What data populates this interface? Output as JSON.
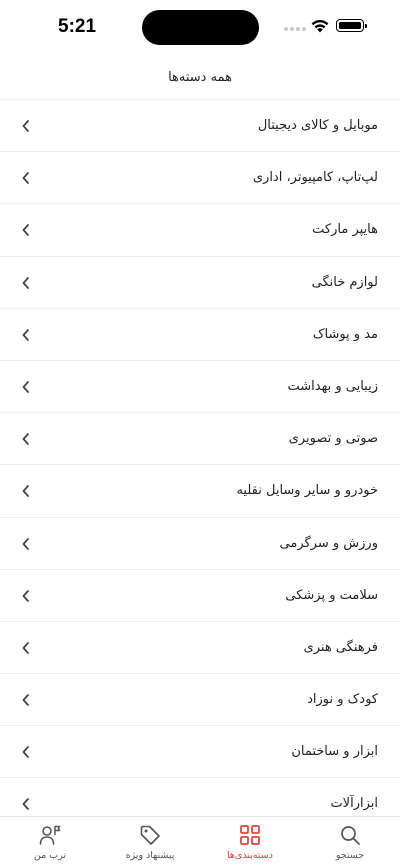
{
  "status_bar": {
    "time": "5:21"
  },
  "header": {
    "title": "همه دسته‌ها"
  },
  "categories": [
    {
      "label": "موبایل و کالای دیجیتال"
    },
    {
      "label": "لپ‌تاپ، کامپیوتر، اداری"
    },
    {
      "label": "هایپر مارکت"
    },
    {
      "label": "لوازم خانگی"
    },
    {
      "label": "مد و پوشاک"
    },
    {
      "label": "زیبایی و بهداشت"
    },
    {
      "label": "صوتی و تصویری"
    },
    {
      "label": "خودرو و سایر وسایل نقلیه"
    },
    {
      "label": "ورزش و سرگرمی"
    },
    {
      "label": "سلامت و پزشکی"
    },
    {
      "label": "فرهنگی هنری"
    },
    {
      "label": "کودک و نوزاد"
    },
    {
      "label": "ابزار و ساختمان"
    },
    {
      "label": "ابزارآلات"
    }
  ],
  "tabbar": {
    "tabs": [
      {
        "label": "جستجو",
        "icon": "search-icon",
        "active": false
      },
      {
        "label": "دسته‌بندی‌ها",
        "icon": "grid-icon",
        "active": true
      },
      {
        "label": "پیشنهاد ویژه",
        "icon": "tag-icon",
        "active": false
      },
      {
        "label": "ترب من",
        "icon": "user-flag-icon",
        "active": false
      }
    ]
  },
  "colors": {
    "accent": "#e0413e",
    "divider": "#ececec",
    "text": "#222222"
  }
}
